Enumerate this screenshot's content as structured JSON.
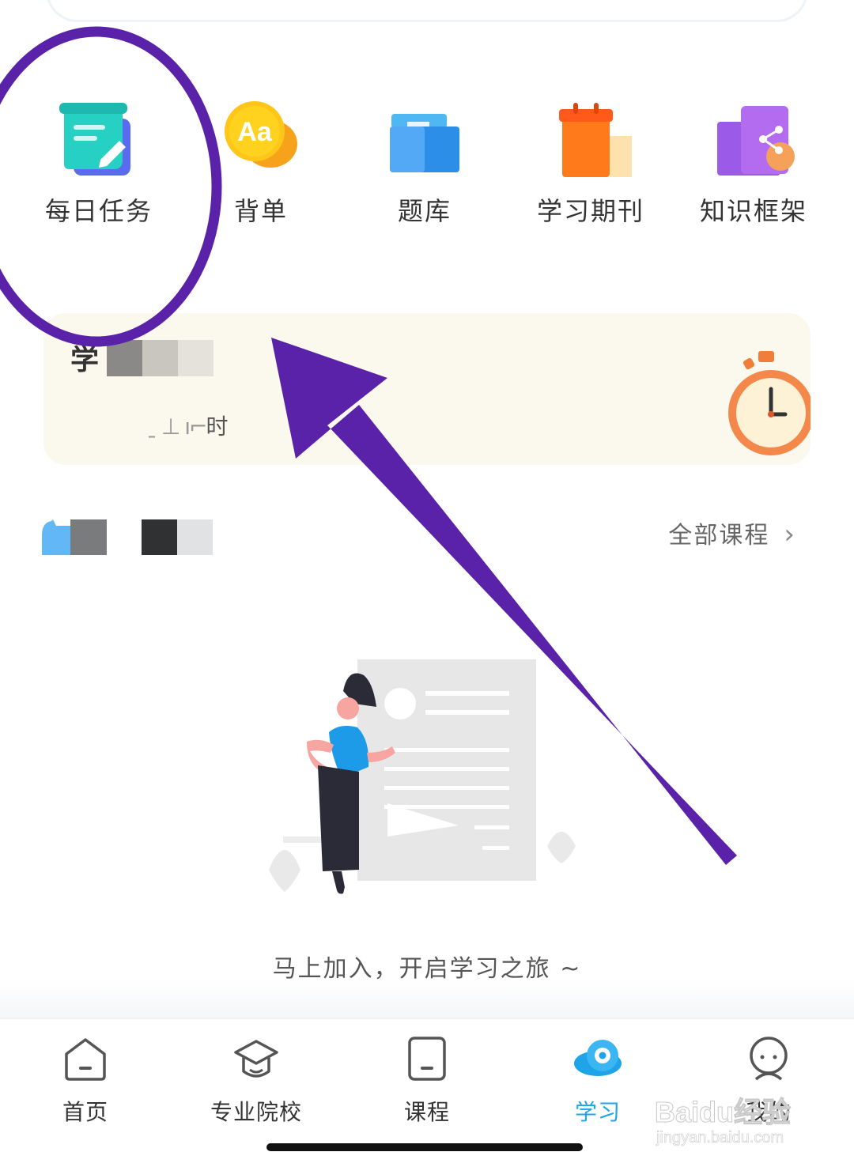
{
  "quick_menu": {
    "items": [
      {
        "label": "每日任务",
        "icon": "daily-task-icon"
      },
      {
        "label": "背单",
        "icon": "vocabulary-icon"
      },
      {
        "label": "题库",
        "icon": "question-bank-icon"
      },
      {
        "label": "学习期刊",
        "icon": "journal-icon"
      },
      {
        "label": "知识框架",
        "icon": "knowledge-framework-icon"
      }
    ],
    "vocab_icon_text": "Aa"
  },
  "study_card": {
    "title": "学",
    "subtitle": "时",
    "icon": "stopwatch-icon"
  },
  "courses": {
    "all_label": "全部课程",
    "chevron": "›"
  },
  "empty_state": {
    "message": "马上加入，开启学习之旅 ~"
  },
  "tabbar": {
    "tabs": [
      {
        "label": "首页",
        "icon": "home-icon"
      },
      {
        "label": "专业院校",
        "icon": "graduation-cap-icon"
      },
      {
        "label": "课程",
        "icon": "course-icon"
      },
      {
        "label": "学习",
        "icon": "study-icon"
      },
      {
        "label": "我的",
        "icon": "profile-icon"
      }
    ],
    "active_index": 3
  },
  "watermark": {
    "brand": "Baidu经验",
    "url": "jingyan.baidu.com"
  },
  "colors": {
    "accent_blue": "#1fa4e8",
    "annotation_purple": "#5a22a8",
    "study_card_bg": "#fbf8ee"
  }
}
